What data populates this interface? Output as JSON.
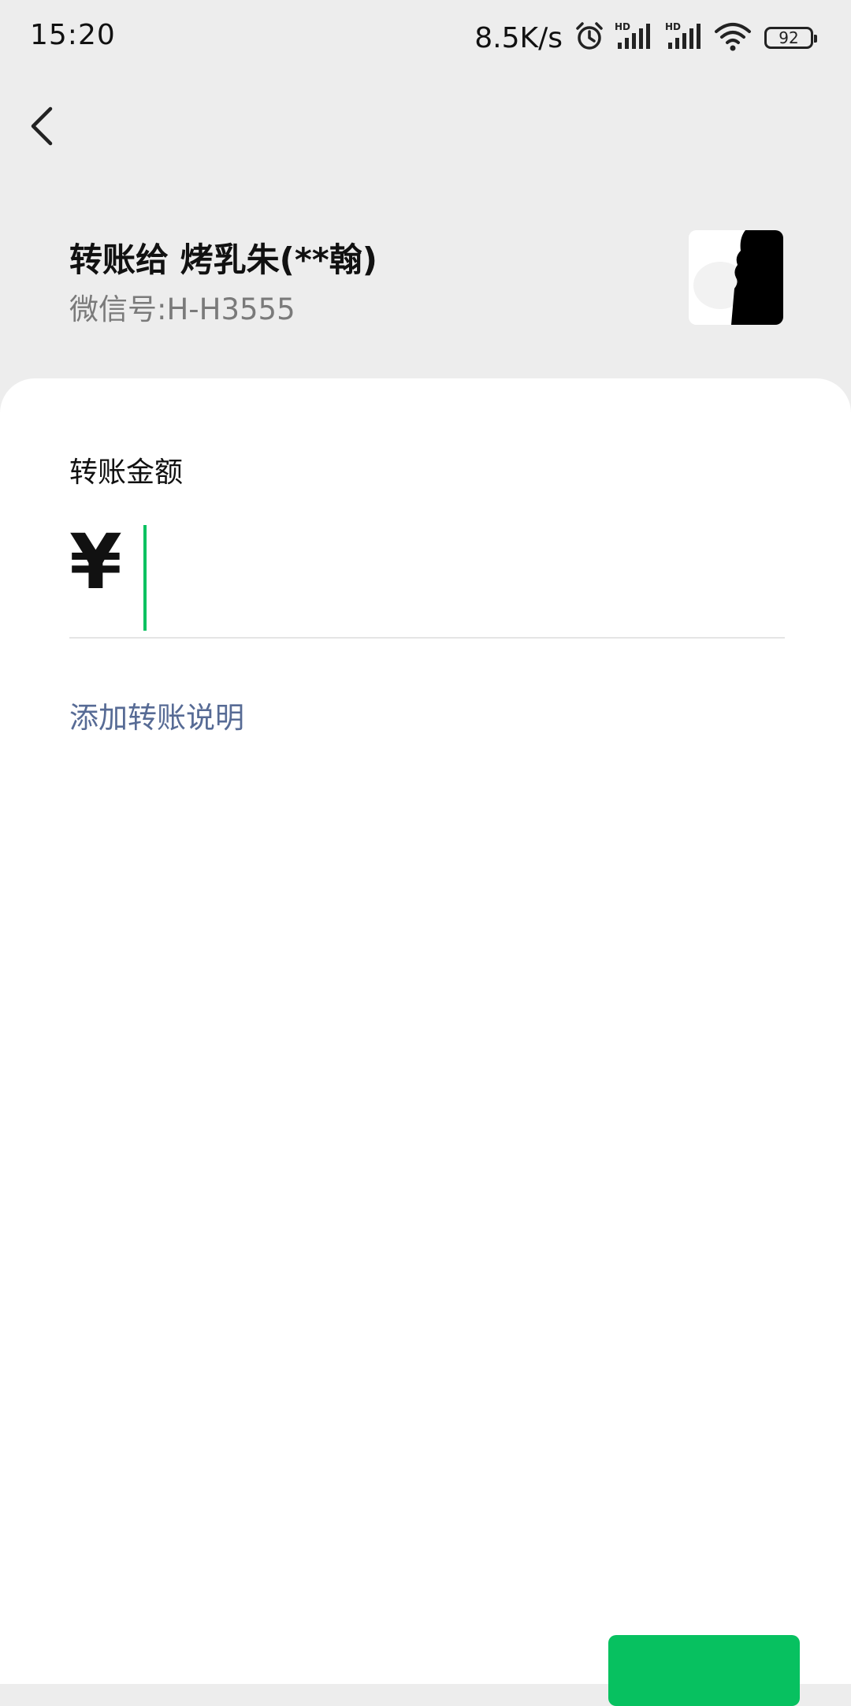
{
  "status_bar": {
    "time": "15:20",
    "network_speed": "8.5K/s",
    "battery_level": "92",
    "icons": [
      "alarm-icon",
      "signal-hd-icon",
      "signal-hd-icon",
      "wifi-icon",
      "battery-icon"
    ]
  },
  "header": {
    "back_icon": "chevron-left-icon"
  },
  "recipient": {
    "title": "转账给 烤乳朱(**翰)",
    "wechat_id": "微信号:H-H3555"
  },
  "transfer": {
    "amount_label": "转账金额",
    "currency_symbol": "¥",
    "amount_value": "",
    "add_note_link": "添加转账说明"
  },
  "colors": {
    "accent": "#07c160",
    "link": "#576b95",
    "header_bg": "#ededed",
    "card_bg": "#ffffff"
  }
}
